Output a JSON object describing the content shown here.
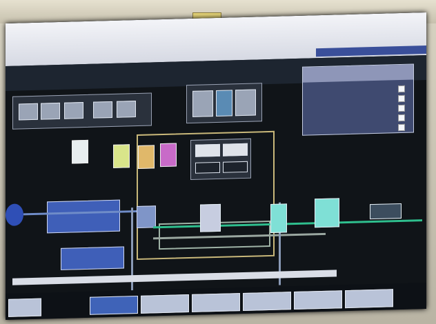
{
  "colors": {
    "screen_bg": "#101418",
    "titlebar": "#eef0f5",
    "accent_blue": "#3f63b8",
    "pipe_green": "#2fbf8e",
    "pipe_gray": "#9aa7a0",
    "tank_teal": "#7fe0d6",
    "panel_bg": "#3f4a70"
  },
  "header": {
    "title": "",
    "subheader": ""
  },
  "info_panel": {
    "heading": "",
    "rows": [
      "",
      "",
      "",
      "",
      ""
    ]
  },
  "process": {
    "labels": [
      "",
      "",
      "",
      "",
      ""
    ]
  },
  "nav": {
    "buttons": [
      {
        "label": "",
        "active": false
      },
      {
        "label": "",
        "active": true
      },
      {
        "label": "",
        "active": false
      },
      {
        "label": "",
        "active": false
      },
      {
        "label": "",
        "active": false
      },
      {
        "label": "",
        "active": false
      },
      {
        "label": "",
        "active": false
      }
    ]
  },
  "icons": [
    "camera-badge-icon",
    "status-dot-icon",
    "pump-icon",
    "tank-icon"
  ]
}
